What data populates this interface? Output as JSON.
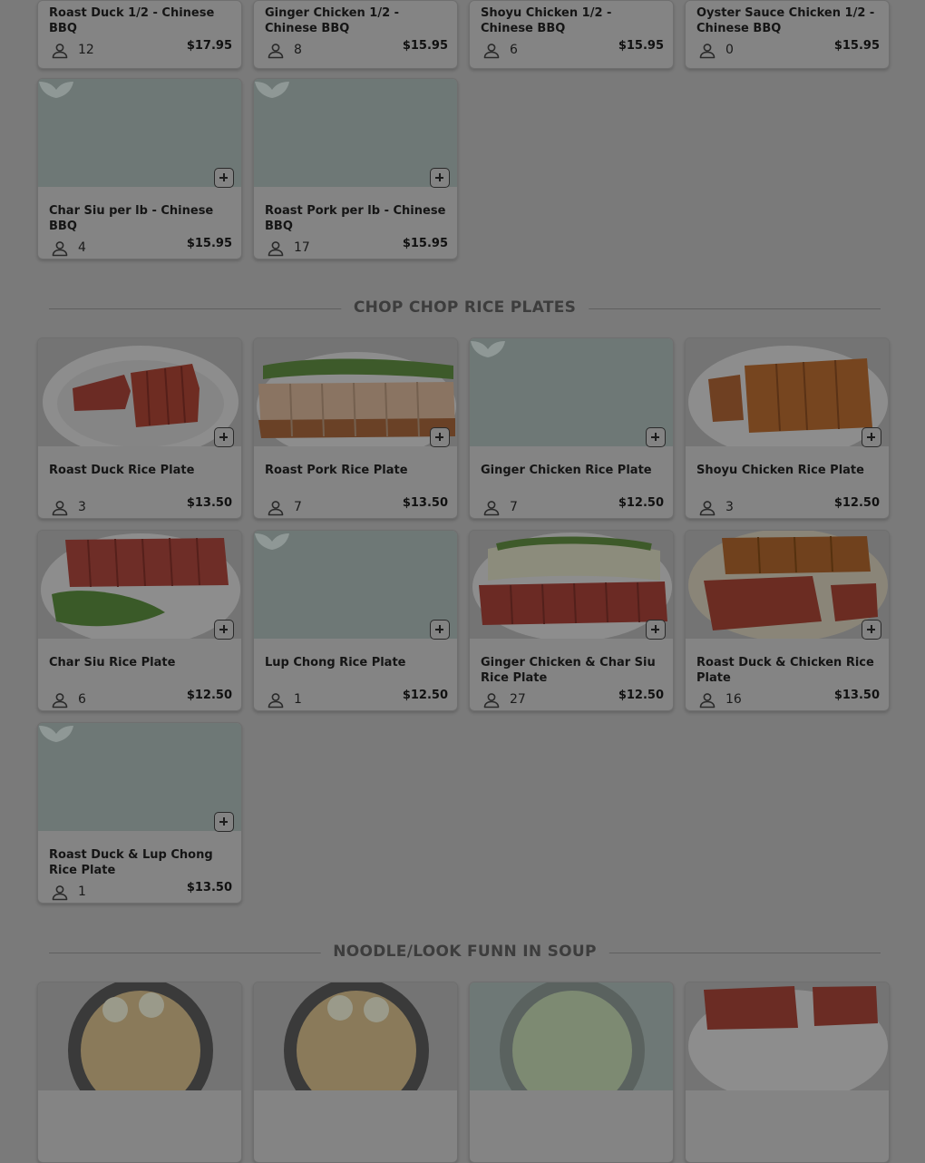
{
  "top_items": [
    {
      "name": "Roast Duck 1/2 - Chinese BBQ",
      "count": "12",
      "price": "$17.95"
    },
    {
      "name": "Ginger Chicken 1/2 - Chinese BBQ",
      "count": "8",
      "price": "$15.95"
    },
    {
      "name": "Shoyu Chicken 1/2 - Chinese BBQ",
      "count": "6",
      "price": "$15.95"
    },
    {
      "name": "Oyster Sauce Chicken 1/2 - Chinese BBQ",
      "count": "0",
      "price": "$15.95"
    },
    {
      "name": "Char Siu per lb - Chinese BBQ",
      "count": "4",
      "price": "$15.95"
    },
    {
      "name": "Roast Pork per lb - Chinese BBQ",
      "count": "17",
      "price": "$15.95"
    }
  ],
  "sections": [
    {
      "title": "CHOP CHOP RICE PLATES",
      "items": [
        {
          "name": "Roast Duck Rice Plate",
          "count": "3",
          "price": "$13.50"
        },
        {
          "name": "Roast Pork Rice Plate",
          "count": "7",
          "price": "$13.50"
        },
        {
          "name": "Ginger Chicken Rice Plate",
          "count": "7",
          "price": "$12.50"
        },
        {
          "name": "Shoyu Chicken Rice Plate",
          "count": "3",
          "price": "$12.50"
        },
        {
          "name": "Char Siu Rice Plate",
          "count": "6",
          "price": "$12.50"
        },
        {
          "name": "Lup Chong Rice Plate",
          "count": "1",
          "price": "$12.50"
        },
        {
          "name": "Ginger Chicken & Char Siu Rice Plate",
          "count": "27",
          "price": "$12.50"
        },
        {
          "name": "Roast Duck & Chicken Rice Plate",
          "count": "16",
          "price": "$13.50"
        },
        {
          "name": "Roast Duck & Lup Chong Rice Plate",
          "count": "1",
          "price": "$13.50"
        }
      ]
    },
    {
      "title": "NOODLE/LOOK FUNN IN SOUP",
      "items": []
    }
  ],
  "icons": {
    "order_count": "person-icon",
    "add": "add-to-cart-icon",
    "placeholder": "placeholder-logo-icon"
  },
  "colors": {
    "overlay": "#7a7a7a",
    "card": "#848484",
    "heading": "#3d3d3d"
  }
}
